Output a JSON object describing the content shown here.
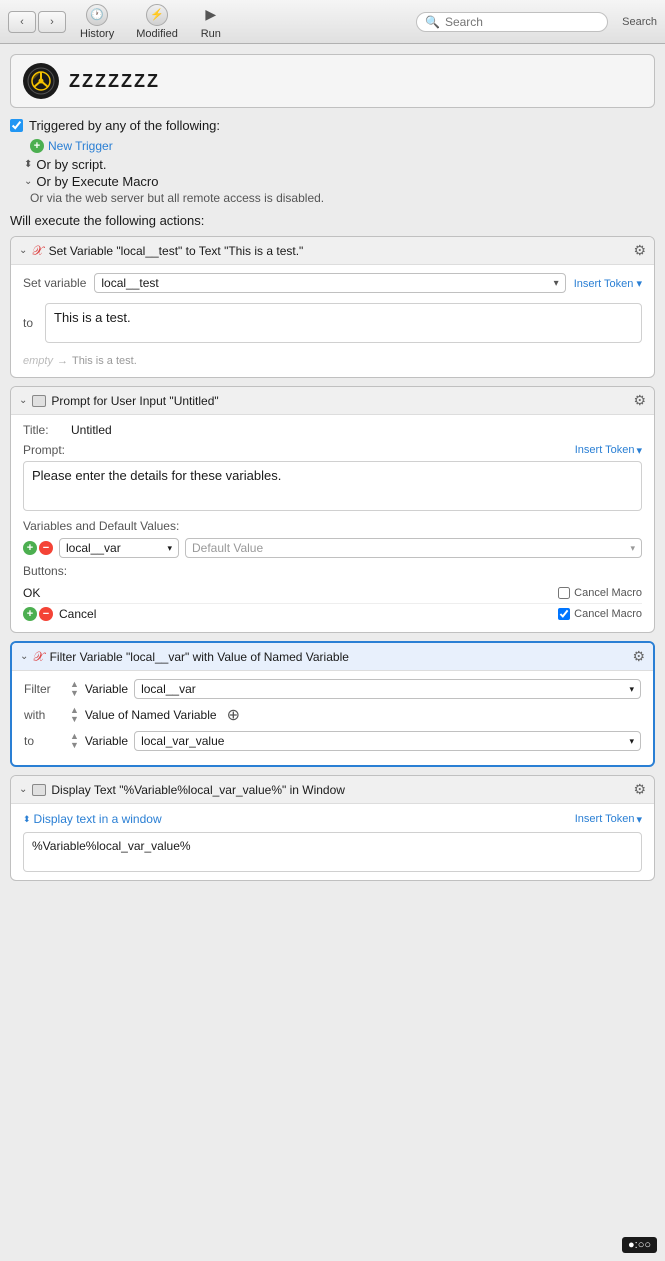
{
  "toolbar": {
    "back_label": "‹",
    "forward_label": "›",
    "history_label": "History",
    "modified_label": "Modified",
    "run_label": "Run",
    "search_placeholder": "Search",
    "search_label_right": "Search"
  },
  "macro": {
    "title": "ZZZZZZZ",
    "triggered_label": "Triggered by any of the following:",
    "new_trigger_label": "New Trigger",
    "or_by_script_label": "Or by script.",
    "or_by_execute_label": "Or by Execute Macro",
    "via_label": "Or via the web server but all remote access is disabled.",
    "will_execute_label": "Will execute the following actions:"
  },
  "action1": {
    "title": "Set Variable \"local__test\" to Text \"This is a test.\"",
    "set_variable_label": "Set variable",
    "variable_name": "local__test",
    "to_label": "to",
    "text_value": "This is a test.",
    "empty_label": "empty",
    "arrow": "→",
    "empty_value": "This is a test."
  },
  "action2": {
    "title": "Prompt for User Input \"Untitled\"",
    "title_label": "Title:",
    "title_value": "Untitled",
    "prompt_label": "Prompt:",
    "insert_token_label": "Insert Token",
    "prompt_text": "Please enter the details for these variables.",
    "variables_label": "Variables and Default Values:",
    "var_name": "local__var",
    "default_value_placeholder": "Default Value",
    "buttons_label": "Buttons:",
    "button1_name": "OK",
    "button1_cancel": false,
    "button1_cancel_label": "Cancel Macro",
    "button2_name": "Cancel",
    "button2_cancel": true,
    "button2_cancel_label": "Cancel Macro"
  },
  "action3": {
    "title": "Filter Variable \"local__var\" with Value of Named Variable",
    "filter_label": "Filter",
    "variable_label": "Variable",
    "variable_name": "local__var",
    "with_label": "with",
    "value_label": "Value of Named Variable",
    "to_label": "to",
    "to_variable_label": "Variable",
    "to_variable_name": "local_var_value"
  },
  "action4": {
    "title": "Display Text \"%Variable%local_var_value%\" in Window",
    "display_label": "Display text in a window",
    "insert_token_label": "Insert Token",
    "display_text": "%Variable%local_var_value%"
  },
  "bottom_time": "●:○○"
}
